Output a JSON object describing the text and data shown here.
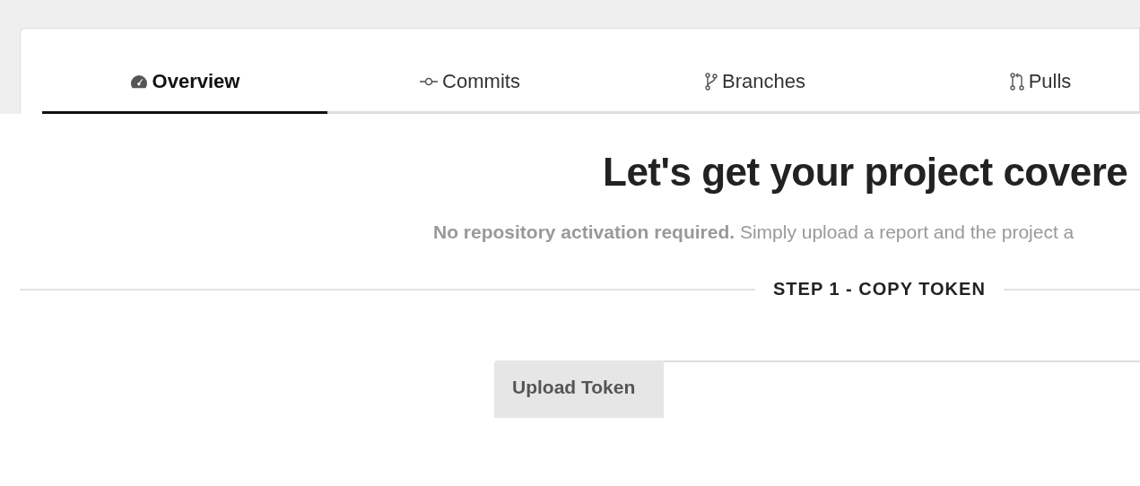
{
  "tabs": [
    {
      "label": "Overview",
      "selected": true
    },
    {
      "label": "Commits",
      "selected": false
    },
    {
      "label": "Branches",
      "selected": false
    },
    {
      "label": "Pulls",
      "selected": false
    }
  ],
  "heading": "Let's get your project covere",
  "subtitle": "**No repository activation required.** Simply upload a report and the project a",
  "step": "STEP 1 - COPY TOKEN",
  "token_field": {
    "label": "Upload Token"
  }
}
